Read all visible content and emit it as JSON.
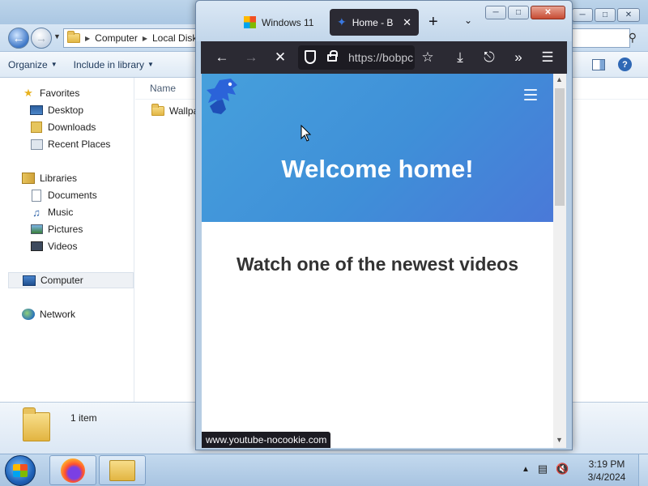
{
  "explorer": {
    "breadcrumb": [
      "Computer",
      "Local Disk (C:)"
    ],
    "toolbar": {
      "organize": "Organize",
      "include_in_library": "Include in library"
    },
    "nav": {
      "favorites": "Favorites",
      "desktop": "Desktop",
      "downloads": "Downloads",
      "recent_places": "Recent Places",
      "libraries": "Libraries",
      "documents": "Documents",
      "music": "Music",
      "pictures": "Pictures",
      "videos": "Videos",
      "computer": "Computer",
      "network": "Network"
    },
    "content": {
      "column_name": "Name",
      "file_name": "Wallpapers"
    },
    "details": {
      "item_count": "1 item"
    }
  },
  "firefox": {
    "tabs": [
      {
        "title": "Windows 11"
      },
      {
        "title": "Home - Bob"
      }
    ],
    "url": "https://bobpc",
    "status_url": "www.youtube-nocookie.com",
    "page": {
      "hero_title": "Welcome home!",
      "section_title": "Watch one of the newest videos"
    }
  },
  "taskbar": {
    "time": "3:19 PM",
    "date": "3/4/2024"
  },
  "colors": {
    "hero": "#3f8fd8",
    "firefox_chrome": "#2b2a33",
    "taskbar": "#b4cde8"
  }
}
